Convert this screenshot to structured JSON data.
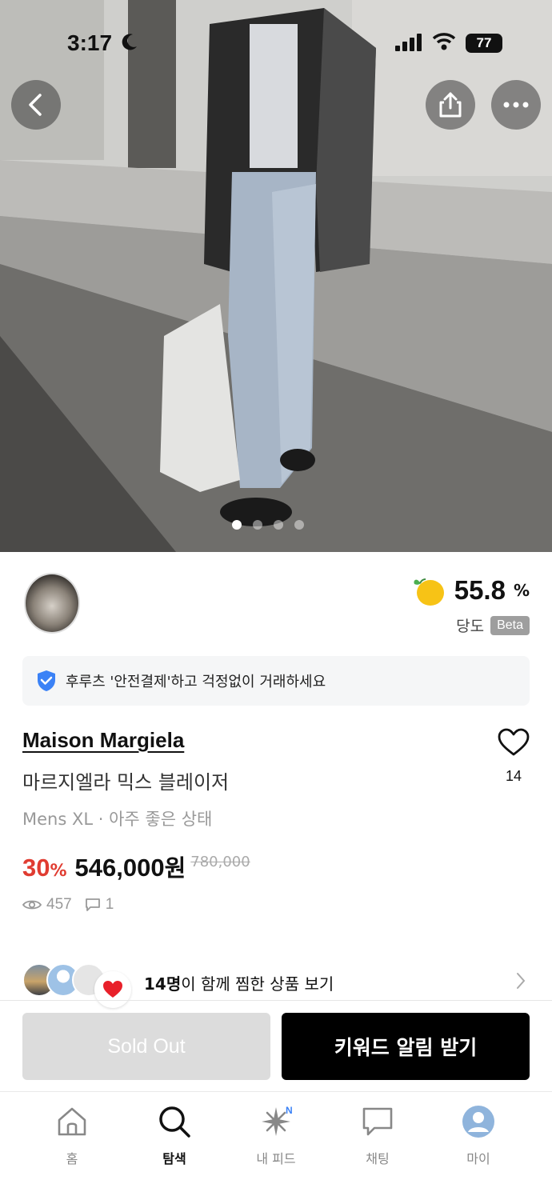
{
  "status_bar": {
    "time": "3:17",
    "battery": "77"
  },
  "product": {
    "brand": "Maison Margiela",
    "title": "마르지엘라 믹스 블레이저",
    "subtitle": "Mens XL · 아주 좋은 상태",
    "discount": "30",
    "discount_unit": "%",
    "price": "546,000",
    "price_unit": "원",
    "original_price": "780,000",
    "views": "457",
    "comments": "1",
    "likes": "14"
  },
  "image_carousel": {
    "total": 4,
    "active_index": 0
  },
  "seller": {
    "sugar_value": "55.8",
    "sugar_unit": "%",
    "sugar_label": "당도",
    "beta_label": "Beta"
  },
  "safe_banner": {
    "text": "후루츠 '안전결제'하고 걱정없이 거래하세요"
  },
  "wishers": {
    "count_text": "14명",
    "text": "이 함께 찜한 상품 보기"
  },
  "actions": {
    "sold_out_label": "Sold Out",
    "keyword_alert_label": "키워드 알림 받기"
  },
  "tabs": [
    {
      "label": "홈",
      "icon": "home-icon"
    },
    {
      "label": "탐색",
      "icon": "search-icon"
    },
    {
      "label": "내 피드",
      "icon": "sparkle-icon",
      "badge": "N"
    },
    {
      "label": "채팅",
      "icon": "chat-icon"
    },
    {
      "label": "마이",
      "icon": "profile-icon"
    }
  ],
  "colors": {
    "discount_red": "#e03c31",
    "primary_button": "#000000",
    "disabled_button": "#dcdcdc",
    "shield_blue": "#3b82f6"
  }
}
